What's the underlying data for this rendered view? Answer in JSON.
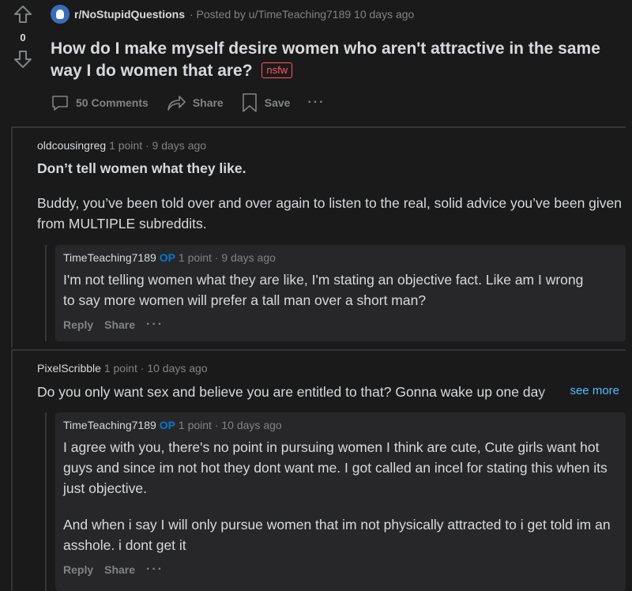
{
  "post": {
    "score": "0",
    "subreddit": "r/NoStupidQuestions",
    "posted_by": "· Posted by u/TimeTeaching7189",
    "age": "10 days ago",
    "title": "How do I make myself desire women who aren't attractive in the same way I do women that are?",
    "nsfw_label": "nsfw",
    "comments_label": "50 Comments",
    "share_label": "Share",
    "save_label": "Save",
    "more_label": "···"
  },
  "comments": [
    {
      "author": "oldcousingreg",
      "points": "1 point",
      "age": "· 9 days ago",
      "bold_line": "Don’t tell women what they like.",
      "body": "Buddy, you’ve been told over and over again to listen to the real, solid advice you’ve been given from MULTIPLE subreddits.",
      "reply": {
        "author": "TimeTeaching7189",
        "op_label": "OP",
        "points": "1 point",
        "age": "· 9 days ago",
        "body": "I'm not telling women what they are like, I'm stating an objective fact. Like am I wrong to say more women will prefer a tall man over a short man?",
        "reply_label": "Reply",
        "share_label": "Share",
        "more_label": "···"
      }
    },
    {
      "author": "PixelScribble",
      "points": "1 point",
      "age": "· 10 days ago",
      "body": "Do you only want sex and believe you are entitled to that? Gonna wake up one day",
      "see_more": "see more",
      "reply": {
        "author": "TimeTeaching7189",
        "op_label": "OP",
        "points": "1 point",
        "age": "· 10 days ago",
        "body": "I agree with you, there's no point in pursuing women I think are cute, Cute girls want hot guys and since im not hot they dont want me. I got called an incel for stating this when its just objective.",
        "body2": "And when i say I will only pursue women that im not physically attracted to i get told im an asshole. i dont get it",
        "reply_label": "Reply",
        "share_label": "Share",
        "more_label": "···"
      }
    }
  ]
}
